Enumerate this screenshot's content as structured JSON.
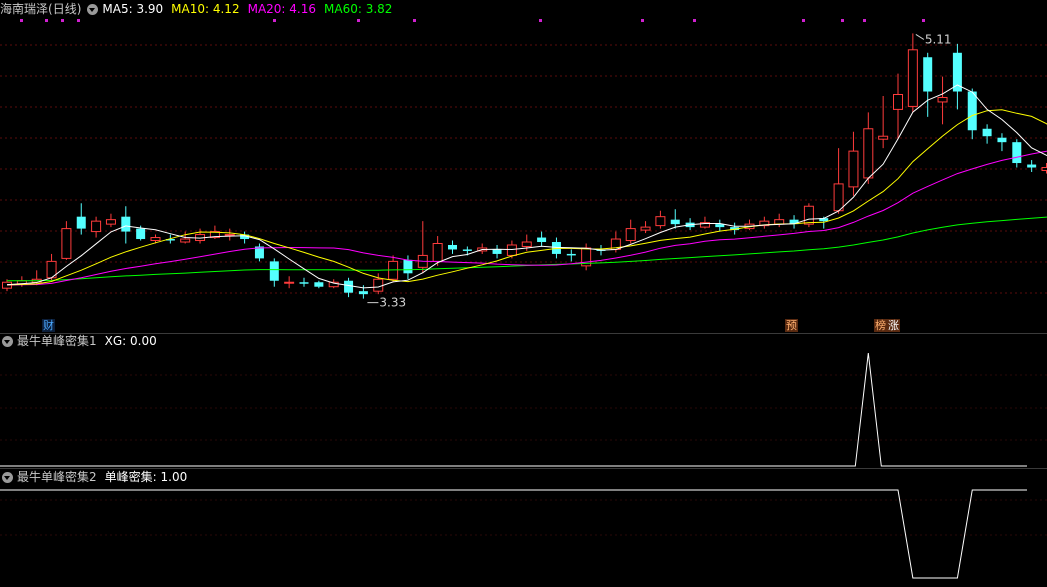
{
  "main_panel": {
    "stock_name": "海南瑞泽",
    "period": "(日线)",
    "indicators": [
      {
        "label": "MA5: 3.90",
        "color": "#ffffff"
      },
      {
        "label": "MA10: 4.12",
        "color": "#ffff00"
      },
      {
        "label": "MA20: 4.16",
        "color": "#ff00ff"
      },
      {
        "label": "MA60: 3.82",
        "color": "#00ff00"
      }
    ],
    "high_label": "5.11",
    "low_label": "3.33",
    "badges": [
      {
        "text": "财",
        "color": "#4aa8ff",
        "bg": "#0b1e3a"
      },
      {
        "text": "预",
        "color": "#ffb070",
        "bg": "#5a2a10"
      },
      {
        "text": "榜",
        "color": "#ffb070",
        "bg": "#5a2a10"
      },
      {
        "text": "涨",
        "color": "#ffffff",
        "bg": "#5a2a10"
      }
    ]
  },
  "colors": {
    "up": "#ff3c3c",
    "down": "#54ffff",
    "ma5": "#ffffff",
    "ma10": "#ffff00",
    "ma20": "#ff00ff",
    "ma60": "#00ff00",
    "grid": "#5a0c0c",
    "marker": "#d020d0"
  },
  "indicator1": {
    "name": "最牛单峰密集1",
    "value_label": "XG: 0.00"
  },
  "indicator2": {
    "name": "最牛单峰密集2",
    "value_label": "单峰密集: 1.00"
  },
  "chart_data": {
    "type": "candlestick",
    "price_range": [
      3.2,
      5.2
    ],
    "candles": [
      [
        3.4,
        3.44,
        3.38,
        3.46
      ],
      [
        3.43,
        3.45,
        3.41,
        3.48
      ],
      [
        3.44,
        3.46,
        3.42,
        3.52
      ],
      [
        3.47,
        3.58,
        3.45,
        3.63
      ],
      [
        3.6,
        3.8,
        3.59,
        3.85
      ],
      [
        3.88,
        3.8,
        3.76,
        3.97
      ],
      [
        3.78,
        3.85,
        3.74,
        3.88
      ],
      [
        3.83,
        3.86,
        3.81,
        3.9
      ],
      [
        3.88,
        3.78,
        3.7,
        3.95
      ],
      [
        3.8,
        3.73,
        3.72,
        3.82
      ],
      [
        3.72,
        3.74,
        3.7,
        3.76
      ],
      [
        3.73,
        3.72,
        3.7,
        3.76
      ],
      [
        3.71,
        3.73,
        3.7,
        3.78
      ],
      [
        3.72,
        3.76,
        3.7,
        3.8
      ],
      [
        3.74,
        3.78,
        3.73,
        3.82
      ],
      [
        3.76,
        3.76,
        3.72,
        3.8
      ],
      [
        3.76,
        3.73,
        3.7,
        3.78
      ],
      [
        3.68,
        3.6,
        3.58,
        3.7
      ],
      [
        3.58,
        3.45,
        3.41,
        3.6
      ],
      [
        3.44,
        3.44,
        3.4,
        3.48
      ],
      [
        3.44,
        3.43,
        3.41,
        3.47
      ],
      [
        3.44,
        3.41,
        3.4,
        3.45
      ],
      [
        3.41,
        3.44,
        3.4,
        3.46
      ],
      [
        3.45,
        3.37,
        3.34,
        3.47
      ],
      [
        3.38,
        3.36,
        3.33,
        3.42
      ],
      [
        3.38,
        3.46,
        3.36,
        3.5
      ],
      [
        3.46,
        3.58,
        3.44,
        3.62
      ],
      [
        3.59,
        3.5,
        3.46,
        3.62
      ],
      [
        3.54,
        3.62,
        3.5,
        3.85
      ],
      [
        3.58,
        3.7,
        3.55,
        3.75
      ],
      [
        3.69,
        3.66,
        3.63,
        3.72
      ],
      [
        3.66,
        3.65,
        3.62,
        3.68
      ],
      [
        3.65,
        3.67,
        3.63,
        3.7
      ],
      [
        3.66,
        3.63,
        3.6,
        3.69
      ],
      [
        3.62,
        3.69,
        3.6,
        3.72
      ],
      [
        3.68,
        3.71,
        3.65,
        3.76
      ],
      [
        3.74,
        3.71,
        3.68,
        3.78
      ],
      [
        3.71,
        3.63,
        3.6,
        3.74
      ],
      [
        3.63,
        3.62,
        3.58,
        3.66
      ],
      [
        3.55,
        3.67,
        3.52,
        3.7
      ],
      [
        3.66,
        3.65,
        3.62,
        3.69
      ],
      [
        3.66,
        3.73,
        3.64,
        3.78
      ],
      [
        3.72,
        3.8,
        3.7,
        3.86
      ],
      [
        3.79,
        3.81,
        3.77,
        3.85
      ],
      [
        3.82,
        3.88,
        3.8,
        3.92
      ],
      [
        3.86,
        3.83,
        3.8,
        3.93
      ],
      [
        3.84,
        3.81,
        3.79,
        3.87
      ],
      [
        3.81,
        3.84,
        3.8,
        3.88
      ],
      [
        3.83,
        3.81,
        3.78,
        3.86
      ],
      [
        3.81,
        3.79,
        3.76,
        3.84
      ],
      [
        3.8,
        3.83,
        3.79,
        3.86
      ],
      [
        3.82,
        3.85,
        3.8,
        3.88
      ],
      [
        3.83,
        3.86,
        3.81,
        3.9
      ],
      [
        3.86,
        3.83,
        3.8,
        3.89
      ],
      [
        3.83,
        3.95,
        3.81,
        3.97
      ],
      [
        3.87,
        3.85,
        3.8,
        3.88
      ],
      [
        3.92,
        4.1,
        3.9,
        4.34
      ],
      [
        4.08,
        4.32,
        4.02,
        4.45
      ],
      [
        4.14,
        4.47,
        4.1,
        4.58
      ],
      [
        4.4,
        4.42,
        4.34,
        4.69
      ],
      [
        4.6,
        4.7,
        4.4,
        4.84
      ],
      [
        4.62,
        5.0,
        4.58,
        5.11
      ],
      [
        4.95,
        4.72,
        4.55,
        4.98
      ],
      [
        4.65,
        4.68,
        4.5,
        4.82
      ],
      [
        4.98,
        4.72,
        4.6,
        5.04
      ],
      [
        4.72,
        4.46,
        4.4,
        4.74
      ],
      [
        4.47,
        4.42,
        4.37,
        4.5
      ],
      [
        4.41,
        4.38,
        4.32,
        4.44
      ],
      [
        4.38,
        4.24,
        4.21,
        4.4
      ],
      [
        4.23,
        4.21,
        4.18,
        4.26
      ],
      [
        4.19,
        4.21,
        4.17,
        4.24
      ],
      [
        4.22,
        4.2,
        4.17,
        4.23
      ],
      [
        4.2,
        4.18,
        4.16,
        4.22
      ]
    ],
    "indicator1_peak_index": 58,
    "indicator2_trough_range": [
      61,
      64
    ]
  }
}
